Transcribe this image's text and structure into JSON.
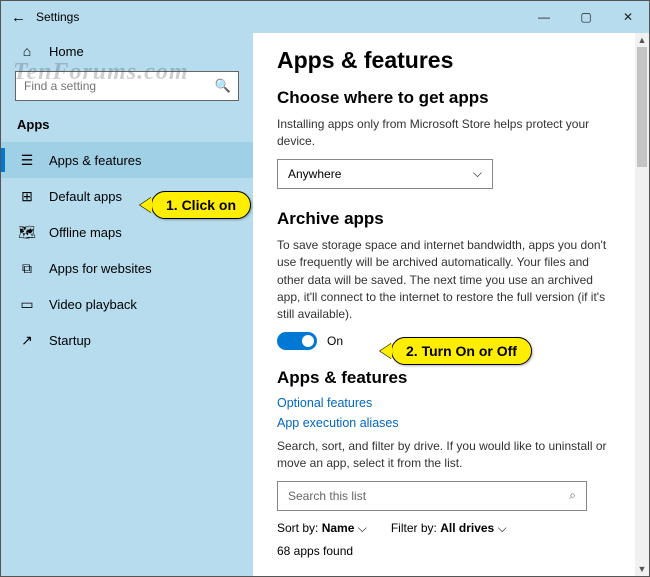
{
  "window": {
    "title": "Settings",
    "controls": {
      "min": "—",
      "max": "▢",
      "close": "✕"
    }
  },
  "sidebar": {
    "home": "Home",
    "search_placeholder": "Find a setting",
    "section": "Apps",
    "items": [
      {
        "icon": "list",
        "label": "Apps & features",
        "selected": true
      },
      {
        "icon": "defaults",
        "label": "Default apps"
      },
      {
        "icon": "map",
        "label": "Offline maps"
      },
      {
        "icon": "web",
        "label": "Apps for websites"
      },
      {
        "icon": "video",
        "label": "Video playback"
      },
      {
        "icon": "startup",
        "label": "Startup"
      }
    ]
  },
  "main": {
    "title": "Apps & features",
    "choose": {
      "heading": "Choose where to get apps",
      "desc": "Installing apps only from Microsoft Store helps protect your device.",
      "dropdown_value": "Anywhere"
    },
    "archive": {
      "heading": "Archive apps",
      "desc": "To save storage space and internet bandwidth, apps you don't use frequently will be archived automatically. Your files and other data will be saved. The next time you use an archived app, it'll connect to the internet to restore the full version (if it's still available).",
      "toggle_state": "On"
    },
    "features": {
      "heading": "Apps & features",
      "link1": "Optional features",
      "link2": "App execution aliases",
      "desc": "Search, sort, and filter by drive. If you would like to uninstall or move an app, select it from the list.",
      "search_placeholder": "Search this list",
      "sort_label": "Sort by:",
      "sort_value": "Name",
      "filter_label": "Filter by:",
      "filter_value": "All drives",
      "count": "68 apps found"
    }
  },
  "annotations": {
    "watermark": "TenForums.com",
    "callout1": "1. Click on",
    "callout2": "2. Turn On or Off"
  }
}
